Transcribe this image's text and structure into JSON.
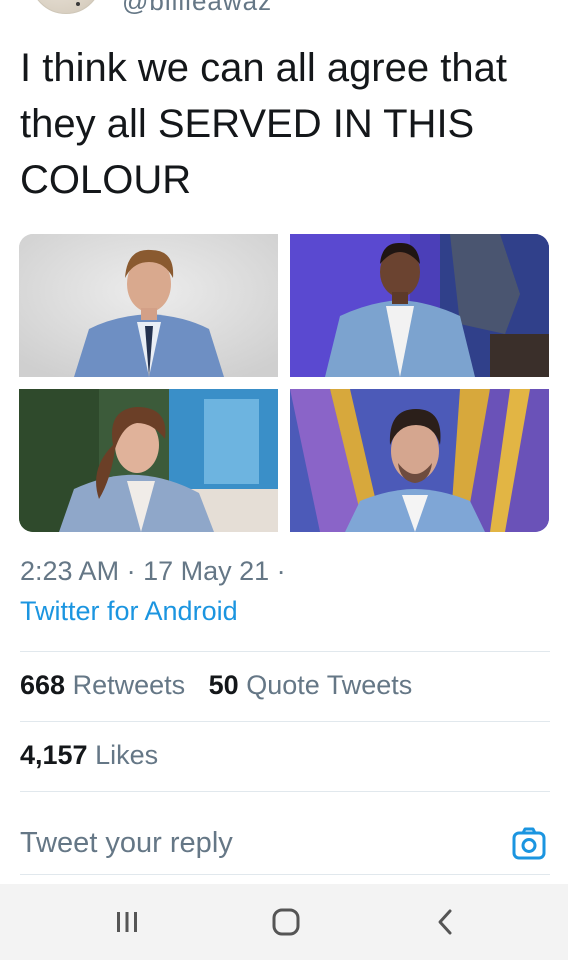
{
  "author": {
    "handle": "@billieawaz",
    "avatar_icon": "profile-avatar"
  },
  "tweet": {
    "text": "I think we can all agree that they all SERVED IN THIS COLOUR"
  },
  "media": {
    "image_count": 4
  },
  "meta": {
    "time": "2:23 AM",
    "separator": " · ",
    "date": "17 May 21",
    "trailing_separator": " ·",
    "source": "Twitter for Android"
  },
  "stats": {
    "retweets_count": "668",
    "retweets_label": " Retweets",
    "quotes_count": "50",
    "quotes_label": " Quote Tweets",
    "likes_count": "4,157",
    "likes_label": " Likes"
  },
  "reply": {
    "placeholder": "Tweet your reply",
    "camera_icon": "camera-icon"
  },
  "system_nav": {
    "recents_icon": "recents-icon",
    "home_icon": "home-icon",
    "back_icon": "back-icon"
  },
  "colors": {
    "link": "#1b95e0",
    "secondary_text": "#657786",
    "primary_text": "#14171a",
    "divider": "#e1e8ed"
  }
}
